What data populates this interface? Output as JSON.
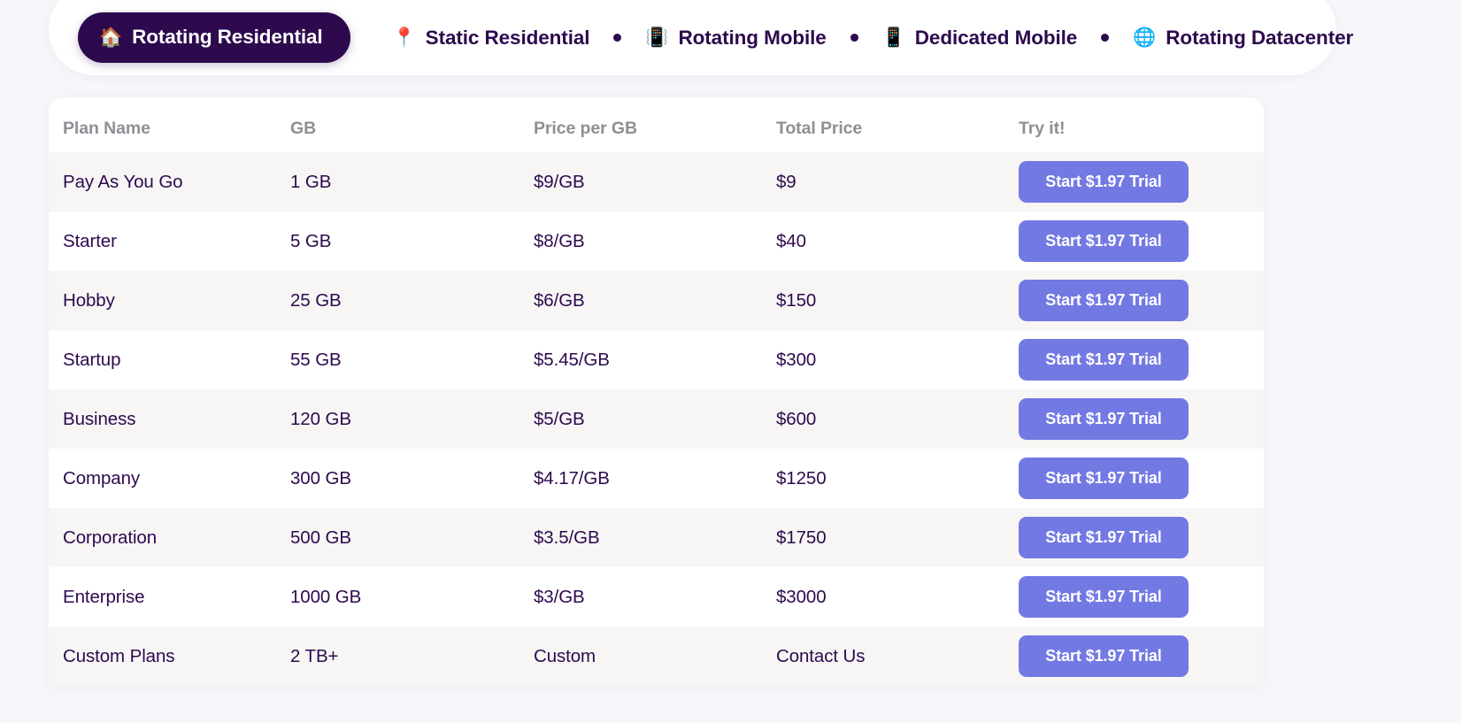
{
  "tabs": [
    {
      "label": "Rotating Residential",
      "icon": "house-icon",
      "glyph": "🏠",
      "active": true
    },
    {
      "label": "Static Residential",
      "icon": "map-pin-icon",
      "glyph": "📍",
      "active": false
    },
    {
      "label": "Rotating Mobile",
      "icon": "vibration-mode-icon",
      "glyph": "📳",
      "active": false
    },
    {
      "label": "Dedicated Mobile",
      "icon": "mobile-phone-icon",
      "glyph": "📱",
      "active": false
    },
    {
      "label": "Rotating Datacenter",
      "icon": "globe-icon",
      "glyph": "🌐",
      "active": false
    }
  ],
  "table": {
    "headers": [
      "Plan Name",
      "GB",
      "Price per GB",
      "Total Price",
      "Try it!"
    ],
    "cta_label": "Start $1.97 Trial",
    "rows": [
      {
        "plan": "Pay As You Go",
        "gb": "1 GB",
        "price_per_gb": "$9/GB",
        "total": "$9"
      },
      {
        "plan": "Starter",
        "gb": "5 GB",
        "price_per_gb": "$8/GB",
        "total": "$40"
      },
      {
        "plan": "Hobby",
        "gb": "25 GB",
        "price_per_gb": "$6/GB",
        "total": "$150"
      },
      {
        "plan": "Startup",
        "gb": "55 GB",
        "price_per_gb": "$5.45/GB",
        "total": "$300"
      },
      {
        "plan": "Business",
        "gb": "120 GB",
        "price_per_gb": "$5/GB",
        "total": "$600"
      },
      {
        "plan": "Company",
        "gb": "300 GB",
        "price_per_gb": "$4.17/GB",
        "total": "$1250"
      },
      {
        "plan": "Corporation",
        "gb": "500 GB",
        "price_per_gb": "$3.5/GB",
        "total": "$1750"
      },
      {
        "plan": "Enterprise",
        "gb": "1000 GB",
        "price_per_gb": "$3/GB",
        "total": "$3000"
      },
      {
        "plan": "Custom Plans",
        "gb": "2 TB+",
        "price_per_gb": "Custom",
        "total": "Contact Us"
      }
    ]
  },
  "colors": {
    "page_background": "#f7f6fa",
    "card_background": "#ffffff",
    "row_stripe": "#f7f6f5",
    "active_tab": "#2d0a4e",
    "text_primary": "#2d0a4e",
    "header_text": "#8f8f96",
    "cta_button": "#7379e3"
  }
}
